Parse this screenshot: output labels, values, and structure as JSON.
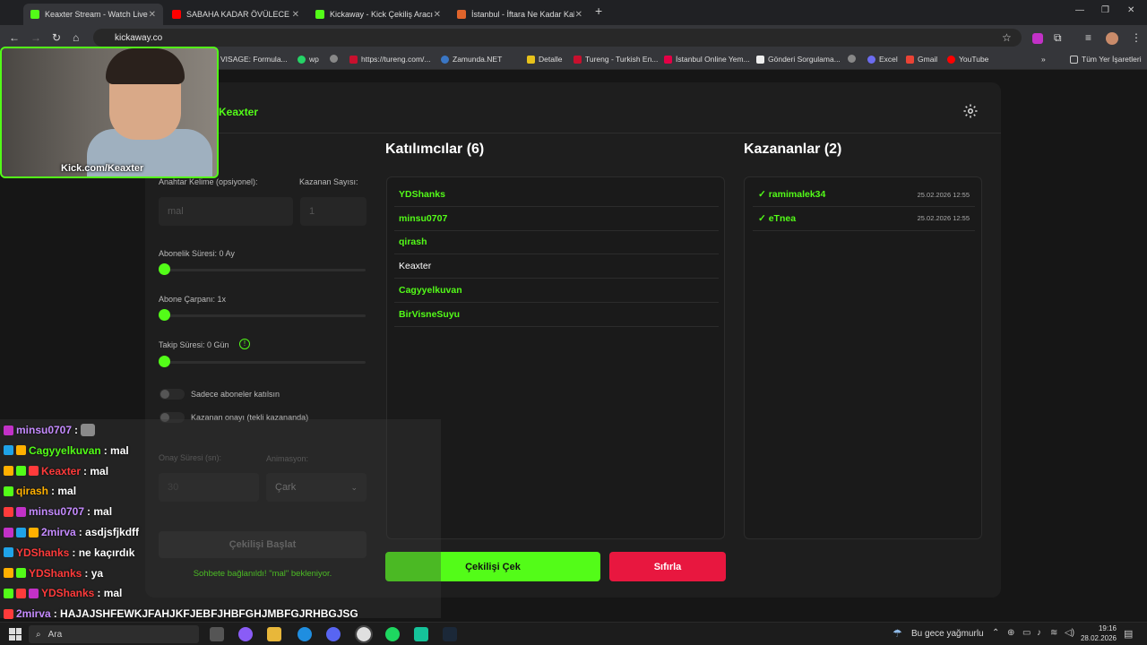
{
  "tabs": [
    {
      "title": "Keaxter Stream - Watch Live on",
      "color": "#53fc18"
    },
    {
      "title": "SABAHA KADAR ÖVÜLECEK OYUN",
      "color": "#ff0000"
    },
    {
      "title": "Kickaway - Kick Çekiliş Aracı",
      "color": "#53fc18"
    },
    {
      "title": "İstanbul - İftara Ne Kadar Kaldı",
      "color": "#e0642b"
    }
  ],
  "url": "kickaway.co",
  "bookmarks": [
    "VISAGE: Formula...",
    "wp",
    "https://tureng.com/...",
    "Zamunda.NET",
    "Detalle",
    "Tureng - Turkish En...",
    "İstanbul Online Yem...",
    "Gönderi Sorgulama...",
    "Excel",
    "Gmail",
    "YouTube",
    "Tüm Yer İşaretleri"
  ],
  "app": {
    "brand": "Keaxter",
    "participants_title": "Katılımcılar (6)",
    "winners_title": "Kazananlar (2)",
    "participants": [
      {
        "name": "YDShanks",
        "sub": true
      },
      {
        "name": "minsu0707",
        "sub": true
      },
      {
        "name": "qirash",
        "sub": true
      },
      {
        "name": "Keaxter",
        "sub": false
      },
      {
        "name": "Cagyyelkuvan",
        "sub": true
      },
      {
        "name": "BirVisneSuyu",
        "sub": true
      }
    ],
    "winners": [
      {
        "name": "✓ ramimalek34",
        "date": "25.02.2026 12:55"
      },
      {
        "name": "✓ eTnea",
        "date": "25.02.2026 12:55"
      }
    ],
    "settings": {
      "keyword_label": "Anahtar Kelime (opsiyonel):",
      "keyword_value": "mal",
      "winner_count_label": "Kazanan Sayısı:",
      "winner_count_value": "1",
      "sub_duration_label": "Abonelik Süresi: 0 Ay",
      "sub_multiplier_label": "Abone Çarpanı: 1x",
      "follow_duration_label": "Takip Süresi: 0 Gün",
      "only_subs_label": "Sadece aboneler katılsın",
      "winner_confirm_label": "Kazanan onayı (tekli kazananda)",
      "confirm_time_label": "Onay Süresi (sn):",
      "confirm_time_value": "30",
      "animation_label": "Animasyon:",
      "animation_value": "Çark",
      "start_button": "Çekilişi Başlat",
      "status_text": "Sohbete bağlanıldı! \"mal\" bekleniyor."
    },
    "draw_button": "Çekilişi Çek",
    "reset_button": "Sıfırla",
    "accent": "#53fc18",
    "danger": "#e8173f"
  },
  "webcam": {
    "tag": "Kick.com/Keaxter"
  },
  "chat": [
    {
      "user": "minsu0707",
      "msg": " : ",
      "ucolor": "#c58bff",
      "emote": true
    },
    {
      "user": "Cagyyelkuvan",
      "msg": " : mal",
      "ucolor": "#53fc18"
    },
    {
      "user": "Keaxter",
      "msg": " : mal",
      "ucolor": "#ff3b3b"
    },
    {
      "user": "qirash",
      "msg": " : mal",
      "ucolor": "#ffb000"
    },
    {
      "user": "minsu0707",
      "msg": " : mal",
      "ucolor": "#c58bff"
    },
    {
      "user": "2mirva",
      "msg": " : asdjsfjkdff",
      "ucolor": "#c58bff"
    },
    {
      "user": "YDShanks",
      "msg": " : ne kaçırdık",
      "ucolor": "#ff3b3b"
    },
    {
      "user": "YDShanks",
      "msg": " : ya",
      "ucolor": "#ff3b3b"
    },
    {
      "user": "YDShanks",
      "msg": " : mal",
      "ucolor": "#ff3b3b"
    },
    {
      "user": "2mirva",
      "msg": " : HAJAJSHFEWKJFAHJKFJEBFJHBFGHJMBFGJRHBGJSG",
      "ucolor": "#c58bff"
    }
  ],
  "taskbar": {
    "search": "Ara",
    "weather": "Bu gece yağmurlu",
    "time": "19:16",
    "date": "28.02.2026"
  }
}
